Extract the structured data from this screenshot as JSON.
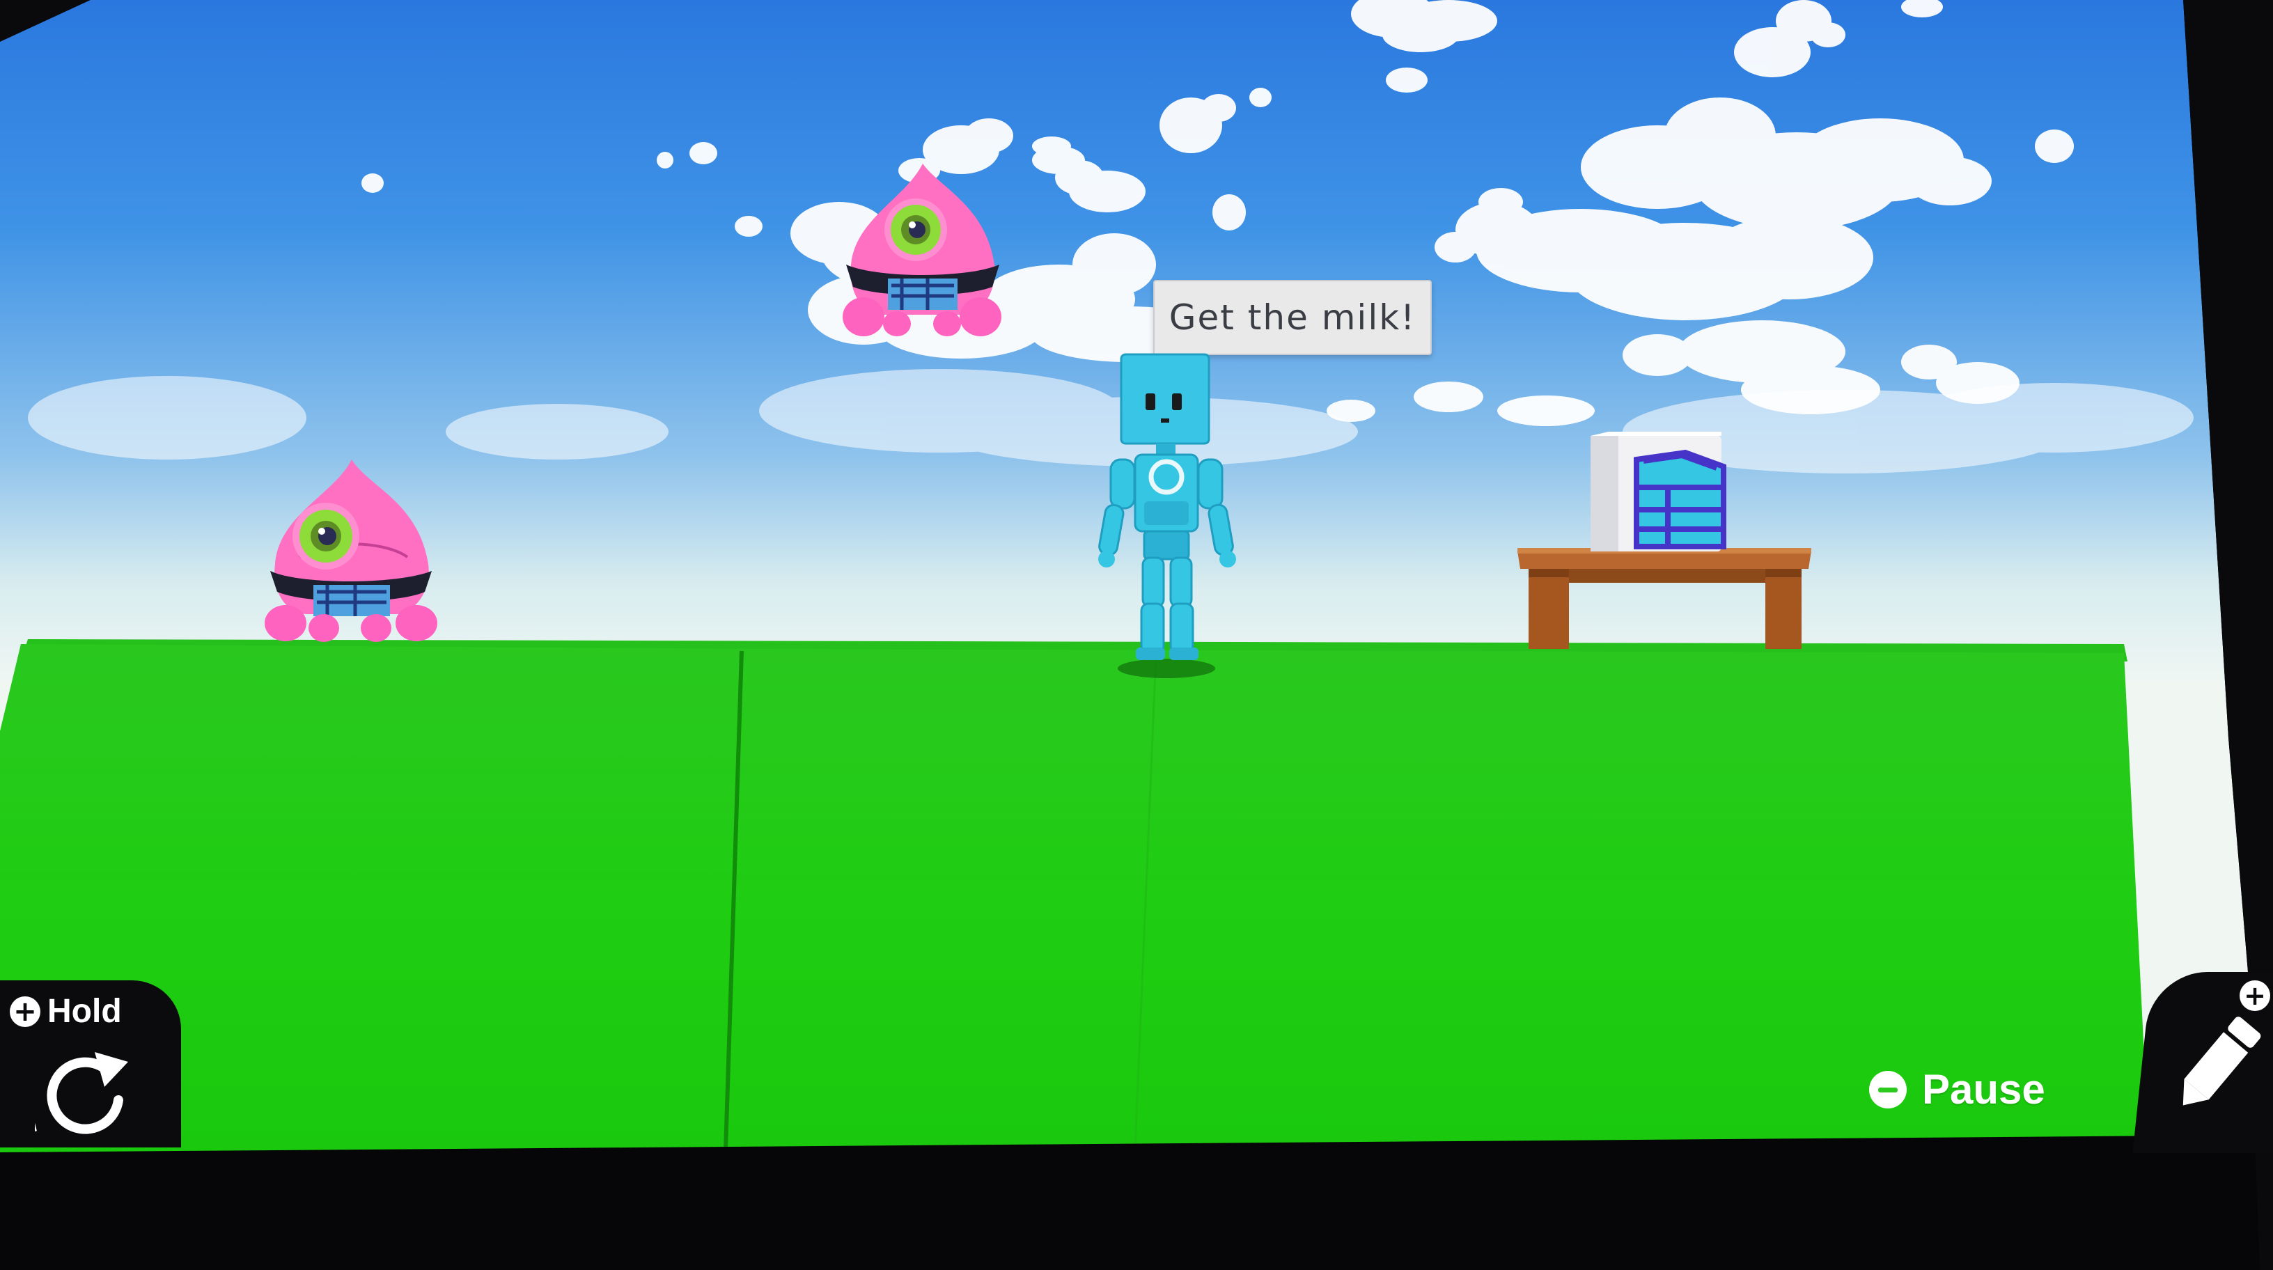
{
  "scene": {
    "speech_bubble": "Get the milk!",
    "colors": {
      "sky_top": "#2b7fe0",
      "sky_horizon": "#eef6f4",
      "ground": "#22cc18",
      "ground_dark": "#18a912",
      "robot": "#35c6e4",
      "monster": "#ff6fc0",
      "table": "#b4622a"
    }
  },
  "hud": {
    "hold_label": "Hold",
    "hold_button_glyph": "+",
    "rotate_icon": "rotate-icon",
    "pause_label": "Pause",
    "pause_button_glyph": "−",
    "edit_icon": "pencil-icon",
    "edit_plus_glyph": "+"
  }
}
